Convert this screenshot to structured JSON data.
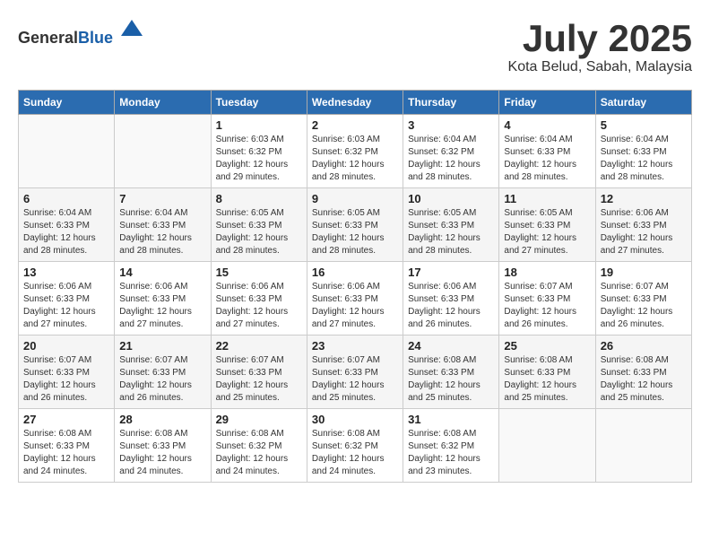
{
  "header": {
    "logo_general": "General",
    "logo_blue": "Blue",
    "month_title": "July 2025",
    "location": "Kota Belud, Sabah, Malaysia"
  },
  "days_of_week": [
    "Sunday",
    "Monday",
    "Tuesday",
    "Wednesday",
    "Thursday",
    "Friday",
    "Saturday"
  ],
  "weeks": [
    [
      {
        "day": "",
        "info": ""
      },
      {
        "day": "",
        "info": ""
      },
      {
        "day": "1",
        "info": "Sunrise: 6:03 AM\nSunset: 6:32 PM\nDaylight: 12 hours and 29 minutes."
      },
      {
        "day": "2",
        "info": "Sunrise: 6:03 AM\nSunset: 6:32 PM\nDaylight: 12 hours and 28 minutes."
      },
      {
        "day": "3",
        "info": "Sunrise: 6:04 AM\nSunset: 6:32 PM\nDaylight: 12 hours and 28 minutes."
      },
      {
        "day": "4",
        "info": "Sunrise: 6:04 AM\nSunset: 6:33 PM\nDaylight: 12 hours and 28 minutes."
      },
      {
        "day": "5",
        "info": "Sunrise: 6:04 AM\nSunset: 6:33 PM\nDaylight: 12 hours and 28 minutes."
      }
    ],
    [
      {
        "day": "6",
        "info": "Sunrise: 6:04 AM\nSunset: 6:33 PM\nDaylight: 12 hours and 28 minutes."
      },
      {
        "day": "7",
        "info": "Sunrise: 6:04 AM\nSunset: 6:33 PM\nDaylight: 12 hours and 28 minutes."
      },
      {
        "day": "8",
        "info": "Sunrise: 6:05 AM\nSunset: 6:33 PM\nDaylight: 12 hours and 28 minutes."
      },
      {
        "day": "9",
        "info": "Sunrise: 6:05 AM\nSunset: 6:33 PM\nDaylight: 12 hours and 28 minutes."
      },
      {
        "day": "10",
        "info": "Sunrise: 6:05 AM\nSunset: 6:33 PM\nDaylight: 12 hours and 28 minutes."
      },
      {
        "day": "11",
        "info": "Sunrise: 6:05 AM\nSunset: 6:33 PM\nDaylight: 12 hours and 27 minutes."
      },
      {
        "day": "12",
        "info": "Sunrise: 6:06 AM\nSunset: 6:33 PM\nDaylight: 12 hours and 27 minutes."
      }
    ],
    [
      {
        "day": "13",
        "info": "Sunrise: 6:06 AM\nSunset: 6:33 PM\nDaylight: 12 hours and 27 minutes."
      },
      {
        "day": "14",
        "info": "Sunrise: 6:06 AM\nSunset: 6:33 PM\nDaylight: 12 hours and 27 minutes."
      },
      {
        "day": "15",
        "info": "Sunrise: 6:06 AM\nSunset: 6:33 PM\nDaylight: 12 hours and 27 minutes."
      },
      {
        "day": "16",
        "info": "Sunrise: 6:06 AM\nSunset: 6:33 PM\nDaylight: 12 hours and 27 minutes."
      },
      {
        "day": "17",
        "info": "Sunrise: 6:06 AM\nSunset: 6:33 PM\nDaylight: 12 hours and 26 minutes."
      },
      {
        "day": "18",
        "info": "Sunrise: 6:07 AM\nSunset: 6:33 PM\nDaylight: 12 hours and 26 minutes."
      },
      {
        "day": "19",
        "info": "Sunrise: 6:07 AM\nSunset: 6:33 PM\nDaylight: 12 hours and 26 minutes."
      }
    ],
    [
      {
        "day": "20",
        "info": "Sunrise: 6:07 AM\nSunset: 6:33 PM\nDaylight: 12 hours and 26 minutes."
      },
      {
        "day": "21",
        "info": "Sunrise: 6:07 AM\nSunset: 6:33 PM\nDaylight: 12 hours and 26 minutes."
      },
      {
        "day": "22",
        "info": "Sunrise: 6:07 AM\nSunset: 6:33 PM\nDaylight: 12 hours and 25 minutes."
      },
      {
        "day": "23",
        "info": "Sunrise: 6:07 AM\nSunset: 6:33 PM\nDaylight: 12 hours and 25 minutes."
      },
      {
        "day": "24",
        "info": "Sunrise: 6:08 AM\nSunset: 6:33 PM\nDaylight: 12 hours and 25 minutes."
      },
      {
        "day": "25",
        "info": "Sunrise: 6:08 AM\nSunset: 6:33 PM\nDaylight: 12 hours and 25 minutes."
      },
      {
        "day": "26",
        "info": "Sunrise: 6:08 AM\nSunset: 6:33 PM\nDaylight: 12 hours and 25 minutes."
      }
    ],
    [
      {
        "day": "27",
        "info": "Sunrise: 6:08 AM\nSunset: 6:33 PM\nDaylight: 12 hours and 24 minutes."
      },
      {
        "day": "28",
        "info": "Sunrise: 6:08 AM\nSunset: 6:33 PM\nDaylight: 12 hours and 24 minutes."
      },
      {
        "day": "29",
        "info": "Sunrise: 6:08 AM\nSunset: 6:32 PM\nDaylight: 12 hours and 24 minutes."
      },
      {
        "day": "30",
        "info": "Sunrise: 6:08 AM\nSunset: 6:32 PM\nDaylight: 12 hours and 24 minutes."
      },
      {
        "day": "31",
        "info": "Sunrise: 6:08 AM\nSunset: 6:32 PM\nDaylight: 12 hours and 23 minutes."
      },
      {
        "day": "",
        "info": ""
      },
      {
        "day": "",
        "info": ""
      }
    ]
  ]
}
